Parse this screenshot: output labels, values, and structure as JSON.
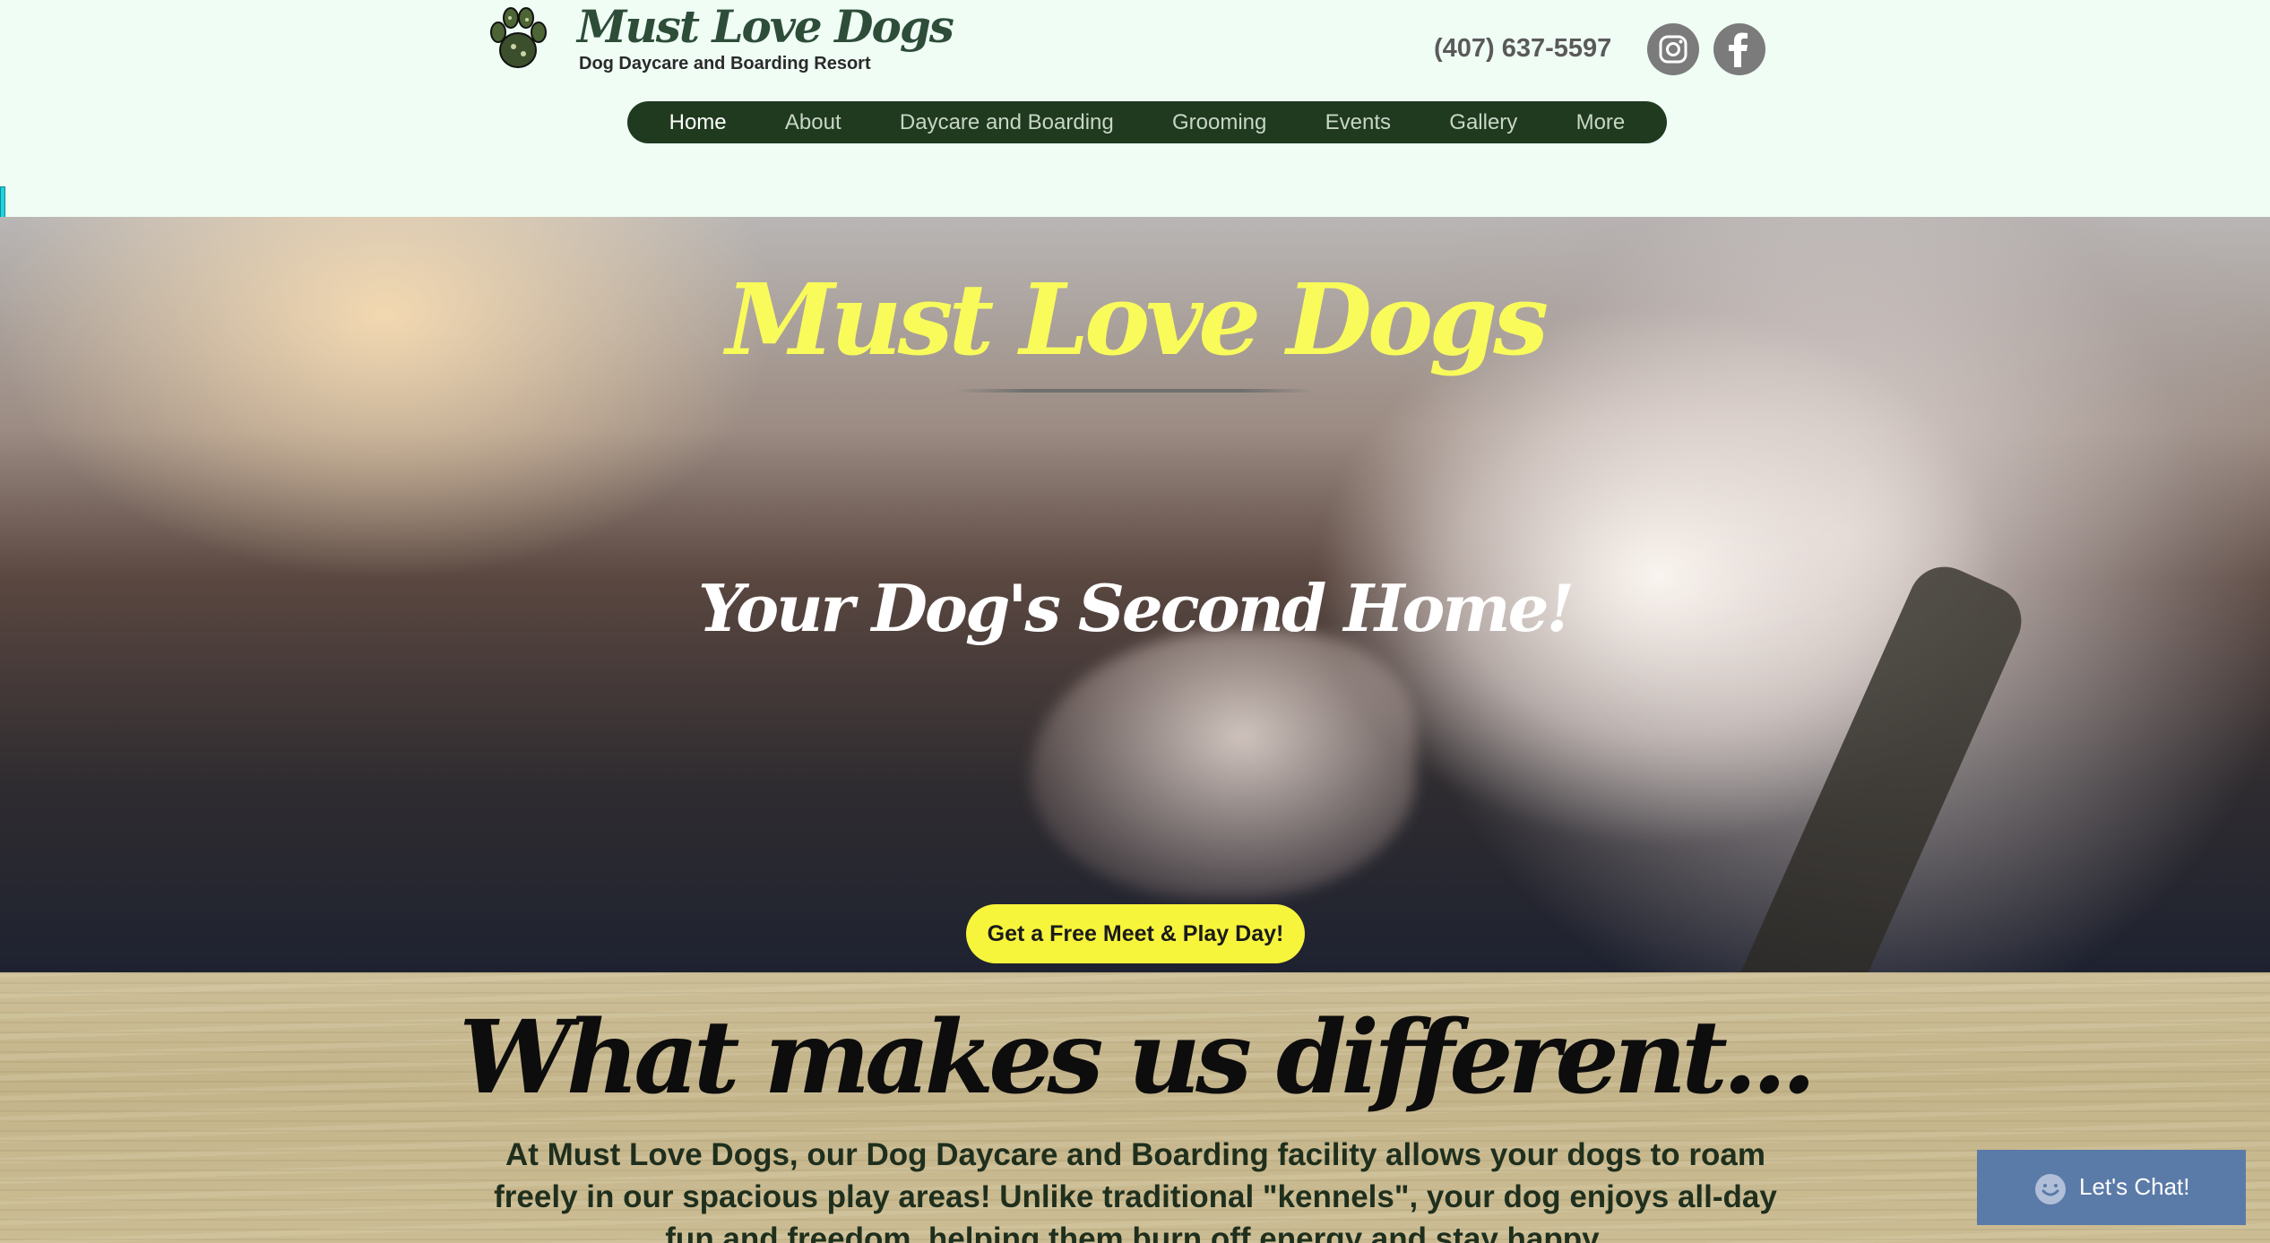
{
  "header": {
    "brand_name": "Must Love Dogs",
    "brand_tagline": "Dog Daycare and Boarding Resort",
    "phone": "(407) 637-5597",
    "social": [
      {
        "icon": "instagram-icon"
      },
      {
        "icon": "facebook-icon"
      }
    ]
  },
  "nav": {
    "items": [
      {
        "label": "Home",
        "active": true
      },
      {
        "label": "About",
        "active": false
      },
      {
        "label": "Daycare and Boarding",
        "active": false
      },
      {
        "label": "Grooming",
        "active": false
      },
      {
        "label": "Events",
        "active": false
      },
      {
        "label": "Gallery",
        "active": false
      },
      {
        "label": "More",
        "active": false
      }
    ]
  },
  "hero": {
    "title": "Must Love Dogs",
    "tagline": "Your Dog's Second Home!",
    "cta_label": "Get a Free Meet & Play Day!"
  },
  "about": {
    "heading": "What makes us different...",
    "body": "At Must Love Dogs, our Dog Daycare and Boarding facility allows your dogs to roam freely in our spacious play areas! Unlike traditional \"kennels\", your dog enjoys all-day fun and freedom, helping them burn off energy and stay happy."
  },
  "chat": {
    "label": "Let's Chat!",
    "icon": "chat-bubble-icon"
  },
  "colors": {
    "page_bg": "#effdf5",
    "nav_bg": "#1f3a1e",
    "brand_green": "#2e4d39",
    "hero_title": "#f9fb5b",
    "cta_bg": "#f7f43c",
    "social_grey": "#7b7b7b",
    "chat_bg": "#5a7aa8"
  }
}
